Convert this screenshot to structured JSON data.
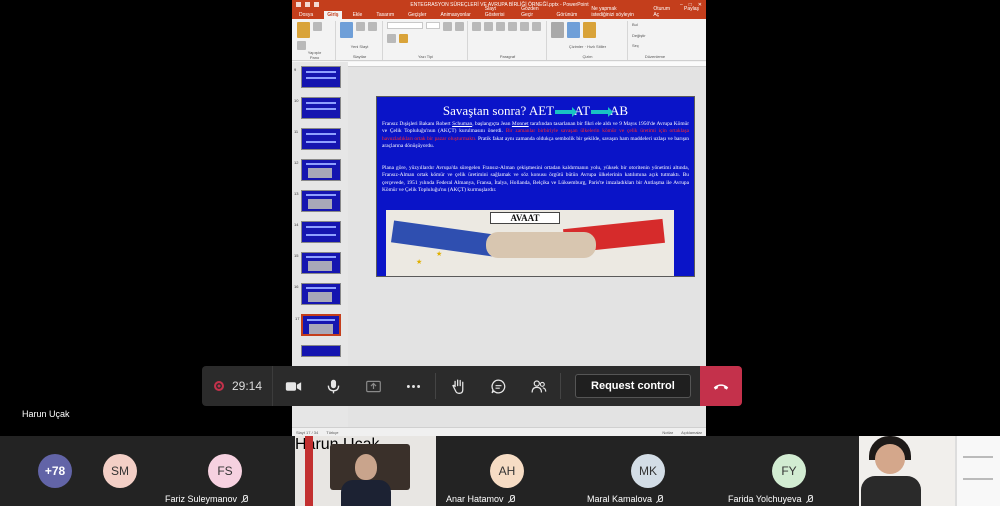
{
  "ppt": {
    "title": "ENTEGRASYON SÜREÇLERİ VE AVRUPA BİRLİĞİ ÖRNEĞİ.pptx  -  PowerPoint",
    "tabs": [
      "Dosya",
      "Giriş",
      "Ekle",
      "Tasarım",
      "Geçişler",
      "Animasyonlar",
      "Slayt Gösterisi",
      "Gözden Geçir",
      "Görünüm"
    ],
    "tell_me": "Ne yapmak istediğinizi söyleyin",
    "signin": "Oturum Aç",
    "share": "Paylaş",
    "ribbon_groups": [
      "Pano",
      "Slaytlar",
      "Yazı Tipi",
      "Paragraf",
      "Çizim",
      "Düzenleme"
    ],
    "ribbon_buttons": [
      "Yapıştır",
      "Yeni Slayt",
      "Çizimler",
      "Hızlı Stiller",
      "Bul",
      "Değiştir",
      "Seç"
    ],
    "slide_numbers": [
      "9",
      "10",
      "11",
      "12",
      "13",
      "14",
      "15",
      "16",
      "17"
    ],
    "status": {
      "slide_of": "Slayt 17 / 34",
      "language": "Türkçe",
      "notes": "Notlar",
      "comments": "Açıklamalar"
    }
  },
  "slide": {
    "title_prefix": "Savaştan sonra?  AET",
    "title_mid": "AT",
    "title_end": "AB",
    "p1_a": "Fransız Dışişleri Bakanı Robert ",
    "p1_schuman": "Schuman",
    "p1_b": ", başlangıçta Jean ",
    "p1_monnet": "Monnet",
    "p1_c": " tarafından tasarlanan bir fikri ele aldı ve 9 Mayıs 1950'de Avrupa Kömür ve Çelik Topluluğu'nun (AKÇT) kurulmasını önerdi. ",
    "p1_red": "Bir zamanlar birbiriyle savaşan ülkelerin kömür ve çelik üretimi için ortaklaşa havuzladıkları ortak bir pazar oluşturmaktı.",
    "p1_d": " Pratik fakat aynı zamanda oldukça sembolik bir şekilde, savaşın ham maddeleri uzlaşı ve barışın araçlarına dönüşüyordu.",
    "p2": "Plana göre, yüzyıllardır Avrupa'da süregelen Fransız-Alman çekişmesini ortadan kaldırmanın yolu, yüksek bir otoritenin yönetimi altında, Fransız-Alman ortak kömür ve çelik üretimini sağlamak ve söz konusu örgütü bütün Avrupa ülkelerinin katılımına açık tutmaktı. Bu çerçevede, 1951 yılında Federal Almanya, Fransa, İtalya, Hollanda, Belçika ve Lüksemburg, Paris'te imzaladıkları bir Antlaşma ile Avrupa Kömür ve Çelik Topluluğu'nu (AKÇT) kurmuşlardır.",
    "cartoon_sign": "AVAAT"
  },
  "controls": {
    "timer": "29:14",
    "request_control": "Request control",
    "icons": [
      "record-icon",
      "camera-icon",
      "mic-icon",
      "share-icon",
      "more-icon",
      "raise-hand-icon",
      "chat-icon",
      "people-icon",
      "hangup-icon"
    ]
  },
  "presenter_name": "Harun Uçak",
  "participants": {
    "overflow": "+78",
    "tiles": [
      {
        "initials": "SM",
        "name": "",
        "color": "#f3cfc6"
      },
      {
        "initials": "FS",
        "name": "Fariz Suleymanov",
        "color": "#f6d1e0"
      },
      {
        "initials": "",
        "name": "Harun Uçak",
        "color": ""
      },
      {
        "initials": "AH",
        "name": "Anar Hatamov",
        "color": "#f6dcc4"
      },
      {
        "initials": "MK",
        "name": "Maral Kamalova",
        "color": "#d3dde6"
      },
      {
        "initials": "FY",
        "name": "Farida Yolchuyeva",
        "color": "#d2ecd2"
      }
    ]
  },
  "colors": {
    "accent_red": "#c4314b",
    "ppt_orange": "#c43e1c",
    "slide_blue": "#0a14c8"
  }
}
